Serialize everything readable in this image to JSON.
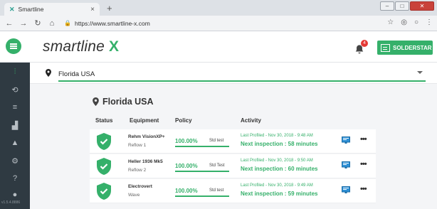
{
  "browser": {
    "tab_title": "Smartline",
    "tab_close": "×",
    "new_tab": "+",
    "url": "https://www.smartline-x.com"
  },
  "app": {
    "logo_text": "smartline",
    "logo_mark": "X",
    "notification_count": "4",
    "solderstar_label": "SOLDERSTAR",
    "accent_color": "#35b06a"
  },
  "sidebar": {
    "items": [
      {
        "icon": "equalizer-icon"
      },
      {
        "icon": "history-icon"
      },
      {
        "icon": "checklist-icon"
      },
      {
        "icon": "chart-icon"
      },
      {
        "icon": "warning-icon"
      },
      {
        "icon": "gear-icon"
      },
      {
        "icon": "help-icon"
      },
      {
        "icon": "user-icon"
      }
    ],
    "footer_text": "v1.5.4.8886"
  },
  "location": {
    "selector_value": "Florida USA",
    "region_title": "Florida USA"
  },
  "table": {
    "headers": {
      "status": "Status",
      "equipment": "Equipment",
      "policy": "Policy",
      "activity": "Activity"
    },
    "rows": [
      {
        "equipment_name": "Rehm VisionXP+",
        "equipment_sub": "Reflow 1",
        "policy_pct": "100.00%",
        "policy_fill": 1.0,
        "policy_name": "Std test",
        "last_profiled": "Last Profiled - Nov 30, 2018 - 9:48 AM",
        "next_inspection": "Next inspection : 58 minutes"
      },
      {
        "equipment_name": "Heller 1936 Mk5",
        "equipment_sub": "Reflow 2",
        "policy_pct": "100.00%",
        "policy_fill": 1.0,
        "policy_name": "Std Test",
        "last_profiled": "Last Profiled - Nov 30, 2018 - 9:50 AM",
        "next_inspection": "Next inspection : 60 minutes"
      },
      {
        "equipment_name": "Electrovert",
        "equipment_sub": "Wave",
        "policy_pct": "100.00%",
        "policy_fill": 1.0,
        "policy_name": "Std test",
        "last_profiled": "Last Profiled - Nov 30, 2018 - 9:49 AM",
        "next_inspection": "Next inspection : 59 minutes"
      }
    ]
  }
}
